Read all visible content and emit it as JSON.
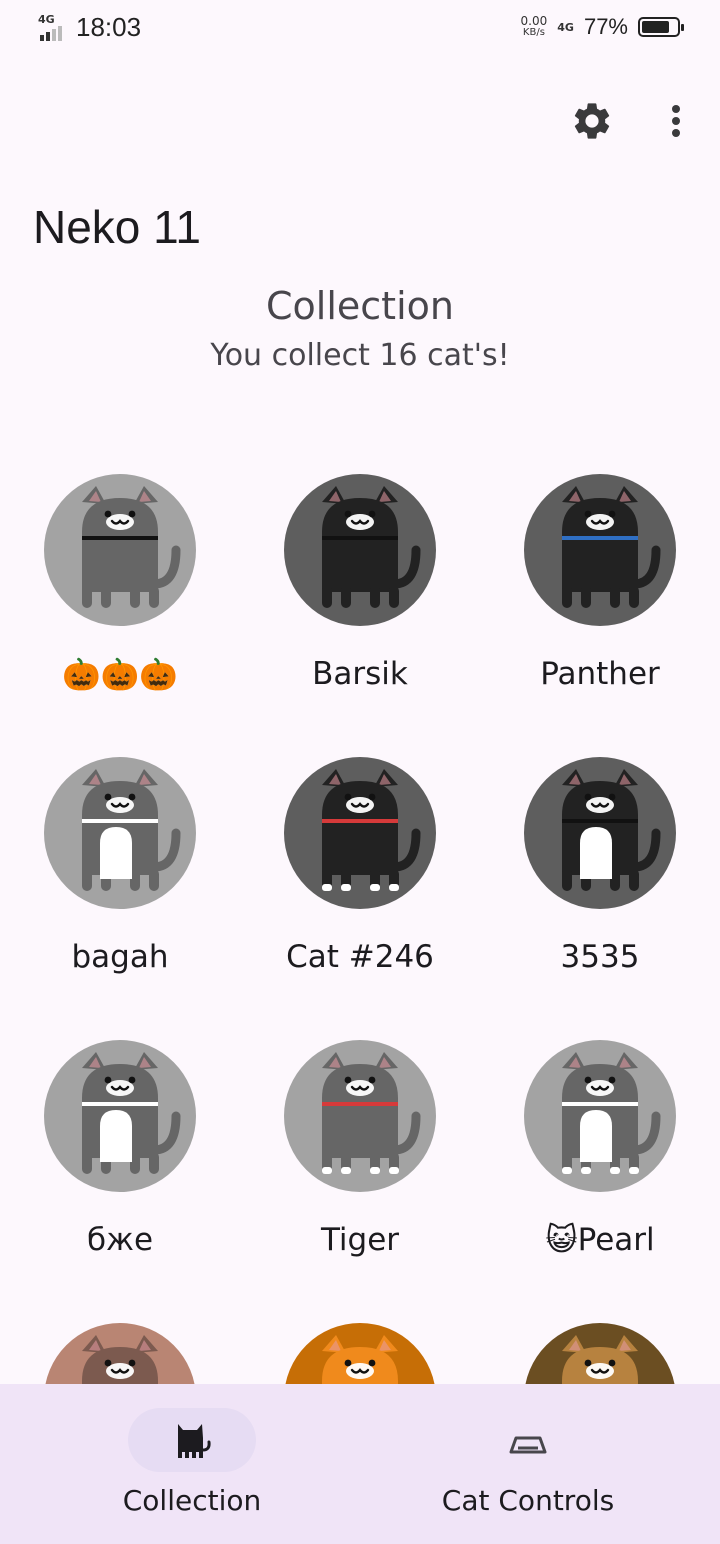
{
  "status_bar": {
    "network_left": "4G",
    "time": "18:03",
    "speed_value": "0.00",
    "speed_unit": "KB/s",
    "network_right": "4G",
    "battery": "77%",
    "battery_level": 0.77
  },
  "toolbar": {
    "settings_icon": "gear-icon",
    "more_icon": "more-vert-icon"
  },
  "app_title": "Neko 11",
  "section": {
    "title": "Collection",
    "subtitle": "You collect 16 cat's!"
  },
  "cats": [
    {
      "name": "🎃🎃🎃",
      "bg": "#a3a3a3",
      "body": "#666666",
      "collar": "#111111",
      "belly": null,
      "feet": null
    },
    {
      "name": "Barsik",
      "bg": "#5e5e5e",
      "body": "#222222",
      "collar": "#111111",
      "belly": null,
      "feet": null
    },
    {
      "name": "Panther",
      "bg": "#5e5e5e",
      "body": "#222222",
      "collar": "#2f6fc4",
      "belly": null,
      "feet": null
    },
    {
      "name": "bagah",
      "bg": "#a3a3a3",
      "body": "#666666",
      "collar": "#ffffff",
      "belly": "#ffffff",
      "feet": null
    },
    {
      "name": "Cat #246",
      "bg": "#5e5e5e",
      "body": "#222222",
      "collar": "#d63a3a",
      "belly": null,
      "feet": "#ffffff"
    },
    {
      "name": "3535",
      "bg": "#5e5e5e",
      "body": "#222222",
      "collar": "#111111",
      "belly": "#ffffff",
      "feet": null
    },
    {
      "name": "бже",
      "bg": "#a3a3a3",
      "body": "#666666",
      "collar": "#ffffff",
      "belly": "#ffffff",
      "feet": null
    },
    {
      "name": "Tiger",
      "bg": "#a3a3a3",
      "body": "#666666",
      "collar": "#d63a3a",
      "belly": null,
      "feet": "#ffffff"
    },
    {
      "name": "😺Pearl",
      "bg": "#a3a3a3",
      "body": "#666666",
      "collar": "#ffffff",
      "belly": "#ffffff",
      "feet": "#ffffff"
    },
    {
      "name": "",
      "bg": "#b98573",
      "body": "#7c5a4f",
      "collar": null,
      "belly": null,
      "feet": null
    },
    {
      "name": "",
      "bg": "#c66e06",
      "body": "#f08a1c",
      "collar": null,
      "belly": null,
      "feet": null
    },
    {
      "name": "",
      "bg": "#6b4e22",
      "body": "#b7823f",
      "collar": null,
      "belly": null,
      "feet": null
    }
  ],
  "bottom_nav": [
    {
      "label": "Collection",
      "icon": "cat-icon",
      "active": true
    },
    {
      "label": "Cat Controls",
      "icon": "food-bowl-icon",
      "active": false
    }
  ]
}
